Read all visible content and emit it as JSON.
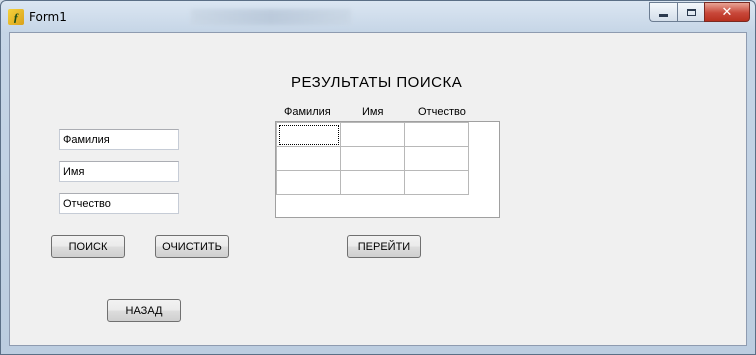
{
  "window": {
    "title": "Form1",
    "close_glyph": "✕"
  },
  "form": {
    "heading": "РЕЗУЛЬТАТЫ ПОИСКА",
    "inputs": {
      "surname": "Фамилия",
      "name": "Имя",
      "patronymic": "Отчество"
    },
    "buttons": {
      "search": "ПОИСК",
      "clear": "ОЧИСТИТЬ",
      "goto": "ПЕРЕЙТИ",
      "back": "НАЗАД"
    },
    "grid": {
      "columns": [
        "Фамилия",
        "Имя",
        "Отчество"
      ],
      "rows": [
        [
          "",
          "",
          ""
        ],
        [
          "",
          "",
          ""
        ],
        [
          "",
          "",
          ""
        ]
      ]
    }
  },
  "icons": {
    "app": "delphi-form-icon"
  }
}
